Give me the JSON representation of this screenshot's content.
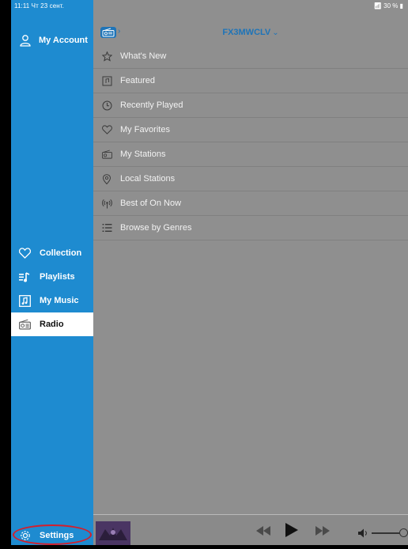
{
  "status": {
    "time_date": "11:11  Чт 23 сент.",
    "battery": "30 %"
  },
  "sidebar": {
    "account_label": "My Account",
    "items": [
      {
        "label": "Collection",
        "icon": "heart-icon"
      },
      {
        "label": "Playlists",
        "icon": "playlist-icon"
      },
      {
        "label": "My Music",
        "icon": "music-note-icon"
      },
      {
        "label": "Radio",
        "icon": "radio-icon",
        "active": true
      }
    ],
    "settings_label": "Settings",
    "accent": "#1e8bd0",
    "highlight_ring": "#d31f2c"
  },
  "header": {
    "station_name": "FX3MWCLV"
  },
  "menu": {
    "items": [
      {
        "label": "What's New",
        "icon": "star-icon"
      },
      {
        "label": "Featured",
        "icon": "featured-icon"
      },
      {
        "label": "Recently Played",
        "icon": "clock-icon"
      },
      {
        "label": "My Favorites",
        "icon": "heart-icon"
      },
      {
        "label": "My Stations",
        "icon": "radio-icon"
      },
      {
        "label": "Local Stations",
        "icon": "location-pin-icon"
      },
      {
        "label": "Best of On Now",
        "icon": "broadcast-icon"
      },
      {
        "label": "Browse by Genres",
        "icon": "list-icon"
      }
    ]
  },
  "player": {
    "controls": [
      "rewind-icon",
      "play-icon",
      "fast-forward-icon",
      "volume-icon"
    ]
  }
}
